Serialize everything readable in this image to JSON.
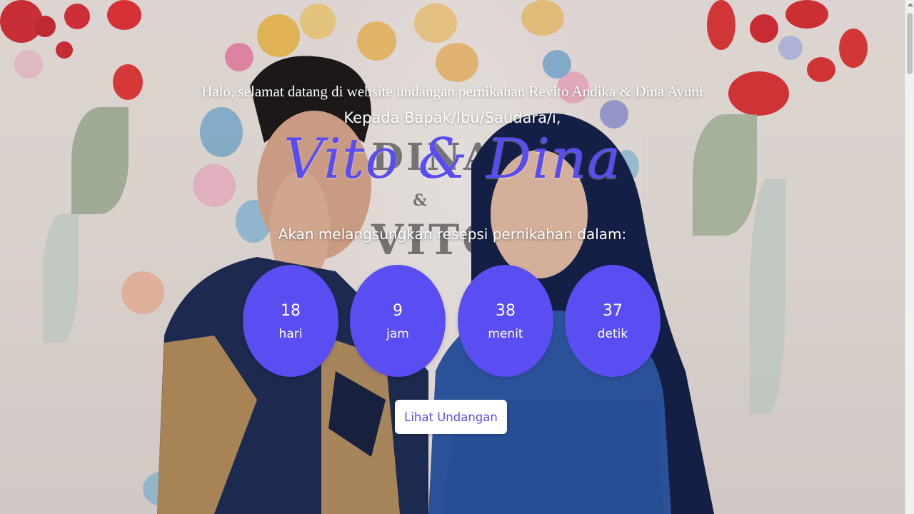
{
  "hero": {
    "welcome_text": "Halo, selamat datang di website undangan pernikahan Revito Andika & Dina Ayuni",
    "guest_greeting": "Kepada Bapak/Ibu/Saudara/i,",
    "couple_names": "Vito & Dina",
    "countdown_caption": "Akan melangsungkan resepsi pernikahan dalam:",
    "backdrop_sign_top": "DINA",
    "backdrop_sign_amp": "&",
    "backdrop_sign_bottom": "VITO"
  },
  "countdown": [
    {
      "value": "18",
      "unit": "hari"
    },
    {
      "value": "9",
      "unit": "jam"
    },
    {
      "value": "38",
      "unit": "menit"
    },
    {
      "value": "37",
      "unit": "detik"
    }
  ],
  "cta": {
    "label": "Lihat Undangan"
  },
  "colors": {
    "accent": "#5a4ef2",
    "button_bg": "#ffffff",
    "text": "#ffffff"
  }
}
